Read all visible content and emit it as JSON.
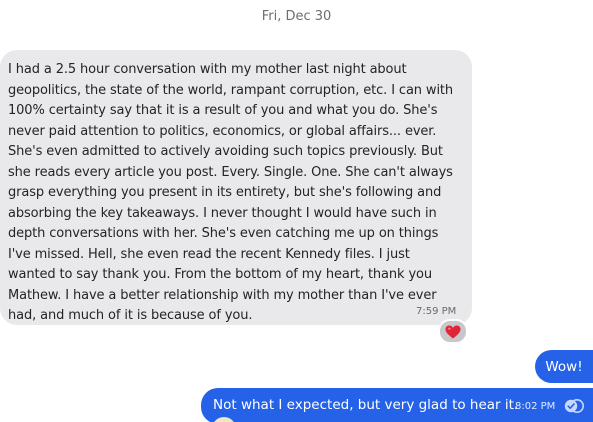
{
  "date_separator": "Fri, Dec 30",
  "incoming_message": {
    "lines": [
      "I had a 2.5 hour conversation with my mother last night about",
      "geopolitics, the state of the world, rampant corruption, etc. I can with",
      "100% certainty say that it is a result of you and what you do. She's",
      "never paid attention to politics, economics, or global affairs... ever.",
      "She's even admitted to actively avoiding such topics previously. But",
      "she reads every article you post. Every. Single. One. She can't always",
      "grasp everything you present in its entirety, but she's following and",
      "absorbing the key takeaways. I never thought I would have such in",
      "depth conversations with her. She's even catching me up on things",
      "I've missed. Hell, she even read the recent Kennedy files. I just",
      "wanted to say thank you. From the bottom of my heart, thank you",
      "Mathew. I have a better relationship with my mother than I've ever",
      "had, and much of it is because of you."
    ],
    "time": "7:59 PM",
    "reaction": "❤️"
  },
  "outgoing_messages": [
    {
      "text": "Wow!"
    },
    {
      "text": "Not what I expected, but very glad to hear it.",
      "time": "8:02 PM",
      "status_icon": "read-receipt-icon"
    }
  ],
  "colors": {
    "incoming_bubble": "#e9e9eb",
    "outgoing_bubble": "#2562e8",
    "reaction_bg": "#c7c7cc"
  }
}
